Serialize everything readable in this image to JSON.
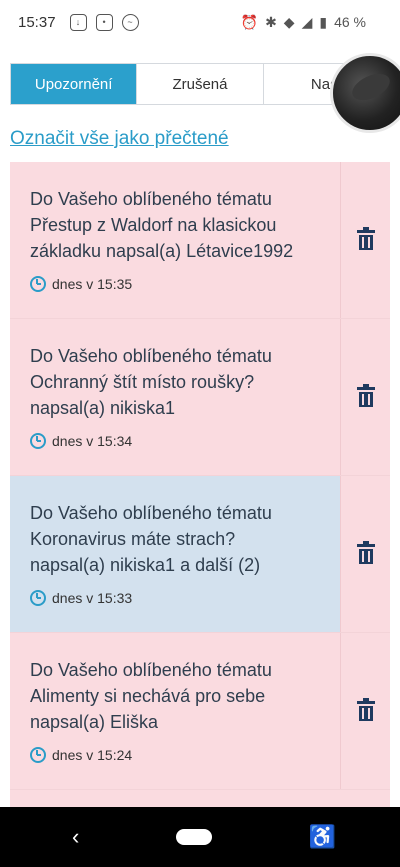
{
  "status": {
    "time": "15:37",
    "battery": "46 %"
  },
  "tabs": [
    {
      "label": "Upozornění",
      "active": true
    },
    {
      "label": "Zrušená",
      "active": false
    },
    {
      "label": "Nast",
      "active": false
    }
  ],
  "mark_all_label": "Označit vše jako přečtené",
  "notifications": [
    {
      "line1": "Do Vašeho oblíbeného tématu",
      "line2": "Přestup z Waldorf na klasickou",
      "line3": "základku napsal(a) Létavice1992",
      "time": "dnes v 15:35",
      "unread": false
    },
    {
      "line1": "Do Vašeho oblíbeného tématu",
      "line2": "Ochranný štít místo roušky?",
      "line3": "napsal(a) nikiska1",
      "time": "dnes v 15:34",
      "unread": false
    },
    {
      "line1": "Do Vašeho oblíbeného tématu",
      "line2": "Koronavirus máte strach?",
      "line3": "napsal(a) nikiska1 a další (2)",
      "time": "dnes v 15:33",
      "unread": true
    },
    {
      "line1": "Do Vašeho oblíbeného tématu",
      "line2": "Alimenty si nechává pro sebe",
      "line3": "napsal(a) Eliška",
      "time": "dnes v 15:24",
      "unread": false
    }
  ],
  "nav": {
    "back": "‹",
    "accessibility": "♿"
  }
}
